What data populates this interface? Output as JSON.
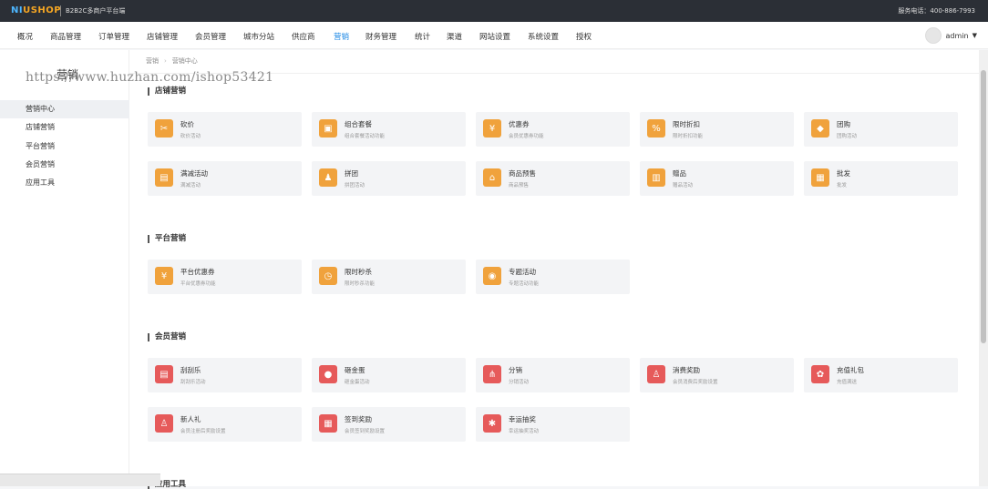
{
  "header": {
    "logo_a": "NI",
    "logo_b": "USHOP",
    "subtitle": "B2B2C多商户平台端",
    "hotline": "服务电话：400-886-7993"
  },
  "nav": {
    "items": [
      "概况",
      "商品管理",
      "订单管理",
      "店铺管理",
      "会员管理",
      "城市分站",
      "供应商",
      "营销",
      "财务管理",
      "统计",
      "渠道",
      "网站设置",
      "系统设置",
      "授权"
    ],
    "active_index": 7,
    "admin": "admin",
    "caret": "▼"
  },
  "sidebar": {
    "title": "营销",
    "items": [
      "营销中心",
      "店铺营销",
      "平台营销",
      "会员营销",
      "应用工具"
    ],
    "active_index": 0
  },
  "watermark": "https://www.huzhan.com/ishop53421",
  "breadcrumb": [
    "营销",
    "营销中心"
  ],
  "sections": [
    {
      "title": "店铺营销"
    },
    {
      "title": "平台营销"
    },
    {
      "title": "会员营销"
    },
    {
      "title": "应用工具"
    }
  ],
  "cards": {
    "store": [
      {
        "name": "砍价",
        "desc": "砍价活动",
        "icon": "bargain-icon",
        "glyph": "✂"
      },
      {
        "name": "组合套餐",
        "desc": "组合套餐活动功能",
        "icon": "combo-icon",
        "glyph": "▣"
      },
      {
        "name": "优惠券",
        "desc": "会员优惠券功能",
        "icon": "coupon-icon",
        "glyph": "¥"
      },
      {
        "name": "限时折扣",
        "desc": "限时折扣功能",
        "icon": "discount-icon",
        "glyph": "%"
      },
      {
        "name": "团购",
        "desc": "团购活动",
        "icon": "groupbuy-icon",
        "glyph": "◆"
      },
      {
        "name": "满减活动",
        "desc": "满减活动",
        "icon": "full-reduction-icon",
        "glyph": "▤"
      },
      {
        "name": "拼团",
        "desc": "拼团活动",
        "icon": "pintuan-icon",
        "glyph": "♟"
      },
      {
        "name": "商品预售",
        "desc": "商品预售",
        "icon": "presale-icon",
        "glyph": "⌂"
      },
      {
        "name": "赠品",
        "desc": "赠品活动",
        "icon": "gift-icon",
        "glyph": "▥"
      },
      {
        "name": "批发",
        "desc": "批发",
        "icon": "wholesale-icon",
        "glyph": "▦"
      }
    ],
    "platform": [
      {
        "name": "平台优惠券",
        "desc": "平台优惠券功能",
        "icon": "platform-coupon-icon",
        "glyph": "¥"
      },
      {
        "name": "限时秒杀",
        "desc": "限时秒杀功能",
        "icon": "seckill-icon",
        "glyph": "◷"
      },
      {
        "name": "专题活动",
        "desc": "专题活动功能",
        "icon": "topic-icon",
        "glyph": "◉"
      }
    ],
    "member": [
      {
        "name": "刮刮乐",
        "desc": "刮刮乐活动",
        "icon": "scratch-card-icon",
        "glyph": "▤"
      },
      {
        "name": "砸金蛋",
        "desc": "砸金蛋活动",
        "icon": "golden-egg-icon",
        "glyph": "●"
      },
      {
        "name": "分销",
        "desc": "分销活动",
        "icon": "distribution-icon",
        "glyph": "⋔"
      },
      {
        "name": "消费奖励",
        "desc": "会员消费后奖励设置",
        "icon": "consume-reward-icon",
        "glyph": "♙"
      },
      {
        "name": "充值礼包",
        "desc": "充值满送",
        "icon": "recharge-gift-icon",
        "glyph": "✿"
      },
      {
        "name": "新人礼",
        "desc": "会员注册后奖励设置",
        "icon": "newcomer-gift-icon",
        "glyph": "♙"
      },
      {
        "name": "签到奖励",
        "desc": "会员签到奖励设置",
        "icon": "signin-reward-icon",
        "glyph": "▦"
      },
      {
        "name": "幸运抽奖",
        "desc": "幸运抽奖活动",
        "icon": "lucky-draw-icon",
        "glyph": "✱"
      }
    ]
  },
  "colors": {
    "accent": "#1e88e5",
    "orange": "#f0a23c",
    "red": "#e65a5a",
    "topbar": "#2b2f36"
  }
}
